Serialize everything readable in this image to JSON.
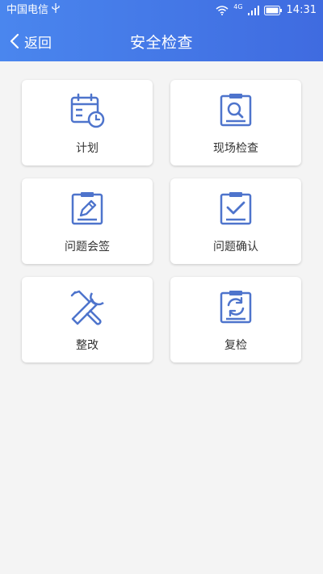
{
  "status_bar": {
    "carrier": "中国电信",
    "usb_icon": "usb-icon",
    "wifi_icon": "wifi-icon",
    "network_label": "4G",
    "signal_icon": "signal-icon",
    "battery_icon": "battery-icon",
    "time": "14:31"
  },
  "nav": {
    "back_label": "返回",
    "title": "安全检查"
  },
  "colors": {
    "header_start": "#4a86ee",
    "header_end": "#3f6be0",
    "icon_blue": "#4e74cc",
    "background": "#f4f4f4"
  },
  "menu": [
    {
      "label": "计划",
      "icon": "calendar-clock-icon"
    },
    {
      "label": "现场检查",
      "icon": "clipboard-search-icon"
    },
    {
      "label": "问题会签",
      "icon": "clipboard-edit-icon"
    },
    {
      "label": "问题确认",
      "icon": "clipboard-check-icon"
    },
    {
      "label": "整改",
      "icon": "tools-icon"
    },
    {
      "label": "复检",
      "icon": "clipboard-refresh-icon"
    }
  ]
}
